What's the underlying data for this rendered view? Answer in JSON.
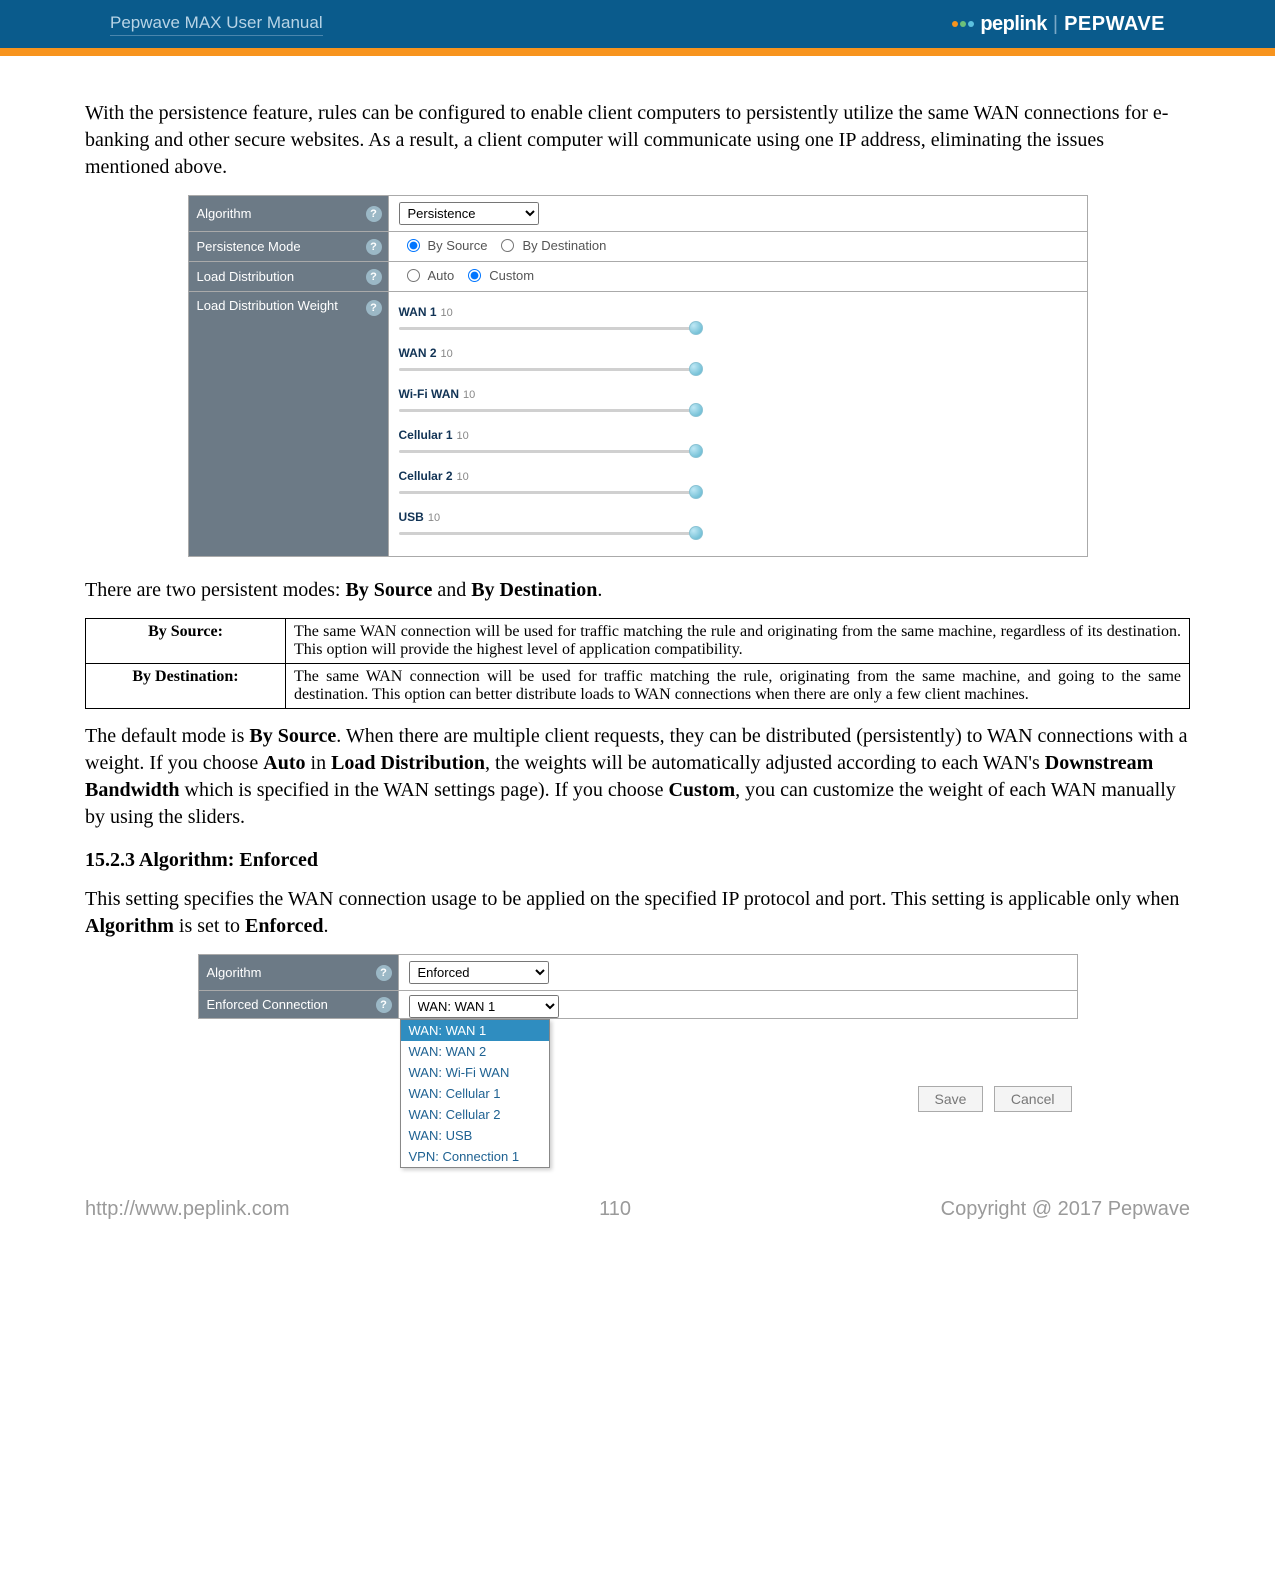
{
  "header": {
    "manual_title": "Pepwave MAX User Manual",
    "brand1": "peplink",
    "brand2": "PEPWAVE"
  },
  "intro_para": "With the persistence feature, rules can be configured to enable client computers to persistently utilize the same WAN connections for e-banking and other secure websites. As a result, a client computer will communicate using one IP address, eliminating the issues mentioned above.",
  "settings1": {
    "algorithm_label": "Algorithm",
    "algorithm_value": "Persistence",
    "persistence_mode_label": "Persistence Mode",
    "mode_opt1": "By Source",
    "mode_opt2": "By Destination",
    "load_dist_label": "Load Distribution",
    "load_opt1": "Auto",
    "load_opt2": "Custom",
    "weight_label": "Load Distribution Weight",
    "weights": [
      {
        "name": "WAN 1",
        "value": "10"
      },
      {
        "name": "WAN 2",
        "value": "10"
      },
      {
        "name": "Wi-Fi WAN",
        "value": "10"
      },
      {
        "name": "Cellular 1",
        "value": "10"
      },
      {
        "name": "Cellular 2",
        "value": "10"
      },
      {
        "name": "USB",
        "value": "10"
      }
    ]
  },
  "modes_intro_prefix": "There are two persistent modes: ",
  "modes_intro_b1": "By Source",
  "modes_intro_mid": " and ",
  "modes_intro_b2": "By Destination",
  "modes_intro_end": ".",
  "modes": {
    "source_name": "By Source:",
    "source_desc": "The same WAN connection will be used for traffic matching the rule and originating from the same machine, regardless of its destination. This option will provide the highest level of application compatibility.",
    "dest_name": "By Destination:",
    "dest_desc": "The same WAN connection will be used for traffic matching the rule, originating from the same machine, and going to the same destination. This option can better distribute loads to WAN connections when there are only a few client machines."
  },
  "default_para": {
    "t1": "The default mode is ",
    "b1": "By Source",
    "t2": ". When there are multiple client requests, they can be distributed (persistently) to WAN connections with a weight. If you choose ",
    "b2": "Auto",
    "t3": " in ",
    "b3": "Load Distribution",
    "t4": ", the weights will be automatically adjusted according to each WAN's ",
    "b4": "Downstream Bandwidth",
    "t5": " which is specified in the WAN settings page). If you choose ",
    "b5": "Custom",
    "t6": ", you can customize the weight of each WAN manually by using the sliders."
  },
  "section_heading": "15.2.3  Algorithm: Enforced",
  "enforced_intro": {
    "t1": "This setting specifies the WAN connection usage to be applied on the specified IP protocol and port. This setting is applicable only when ",
    "b1": "Algorithm",
    "t2": " is set to ",
    "b2": "Enforced",
    "t3": "."
  },
  "settings2": {
    "algorithm_label": "Algorithm",
    "algorithm_value": "Enforced",
    "enforced_conn_label": "Enforced Connection",
    "selected": "WAN: WAN 1",
    "options": [
      "WAN: WAN 1",
      "WAN: WAN 2",
      "WAN: Wi-Fi WAN",
      "WAN: Cellular 1",
      "WAN: Cellular 2",
      "WAN: USB",
      "VPN: Connection 1"
    ],
    "buttons": {
      "save": "Save",
      "cancel": "Cancel"
    }
  },
  "footer": {
    "url": "http://www.peplink.com",
    "page": "110",
    "copyright": "Copyright @ 2017 Pepwave"
  },
  "help_glyph": "?"
}
